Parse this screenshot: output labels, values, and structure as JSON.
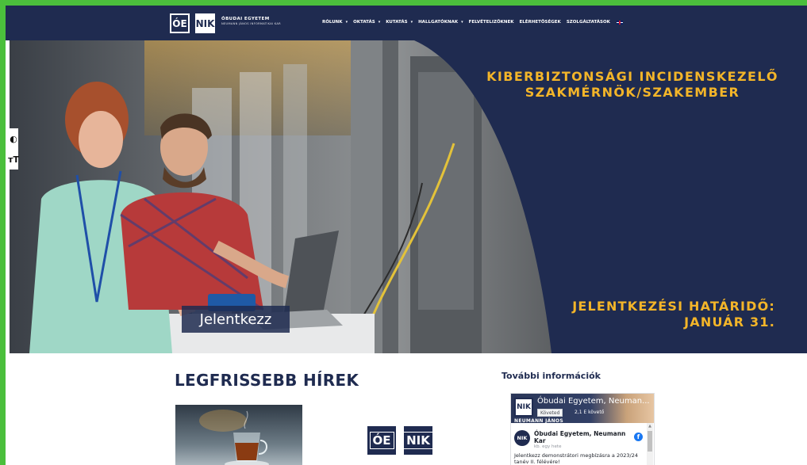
{
  "header": {
    "logo_oe": "ÓE",
    "logo_nik": "NIK",
    "org_line1": "ÓBUDAI EGYETEM",
    "org_line2": "NEUMANN JÁNOS INFORMATIKAI KAR",
    "nav": [
      {
        "label": "RÓLUNK",
        "caret": "▾"
      },
      {
        "label": "OKTATÁS",
        "caret": "▾"
      },
      {
        "label": "KUTATÁS",
        "caret": "▾"
      },
      {
        "label": "HALLGATÓKNAK",
        "caret": "▾"
      },
      {
        "label": "FELVÉTELIZŐKNEK",
        "caret": ""
      },
      {
        "label": "ELÉRHETŐSÉGEK",
        "caret": ""
      },
      {
        "label": "SZOLGÁLTATÁSOK",
        "caret": ""
      }
    ],
    "language_flag_icon": "uk-flag-icon"
  },
  "hero": {
    "title_line1": "KIBERBIZTONSÁGI INCIDENSKEZELŐ",
    "title_line2": "SZAKMÉRNÖK/SZAKEMBER",
    "deadline_line1": "JELENTKEZÉSI HATÁRIDŐ:",
    "deadline_line2": "JANUÁR 31.",
    "apply_button": "Jelentkezz",
    "colors": {
      "accent": "#f3b529",
      "navy": "#1f2b50"
    }
  },
  "accessibility": {
    "contrast_icon": "◐",
    "font_size_icon": "ᴛT"
  },
  "news": {
    "heading": "LEGFRISSEBB HÍREK",
    "logo_oe": "ÓE",
    "logo_nik": "NIK"
  },
  "sidebar": {
    "heading": "További információk",
    "facebook": {
      "page_name": "Óbudai Egyetem, Neuman...",
      "follow_label": "Követed",
      "followers": "2,1 E követő",
      "cover_text": "NEUMANN JÁNOS",
      "post_author": "Óbudai Egyetem, Neumann Kar",
      "post_time": "kb. egy hete",
      "post_text": "Jelentkezz demonstrátori megbízásra a 2023/24 tanév II. félévére!",
      "avatar_text": "NIK",
      "verified_icon": "facebook-icon"
    }
  }
}
